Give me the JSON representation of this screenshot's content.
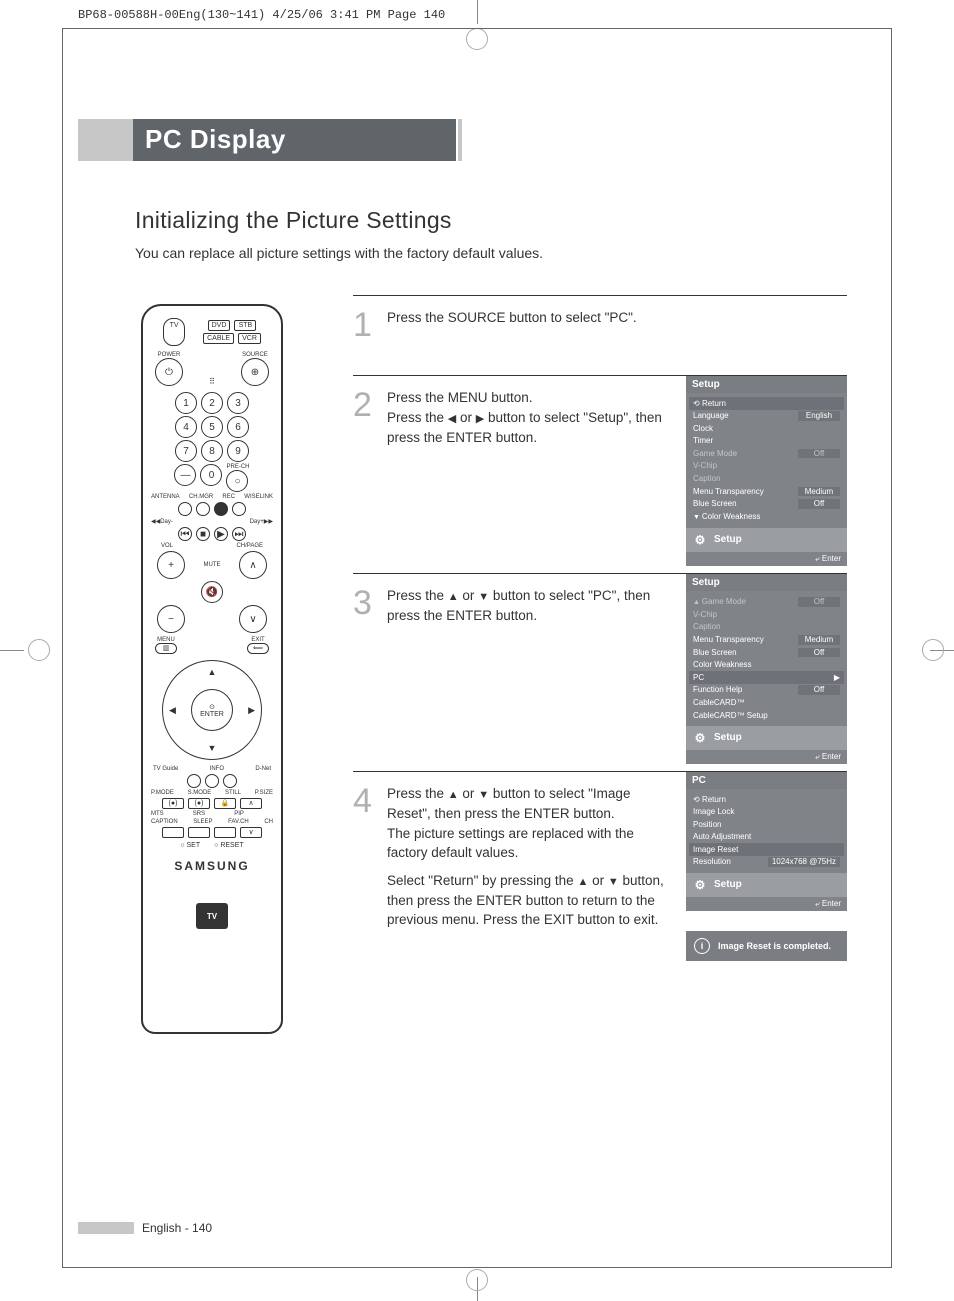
{
  "print_header": "BP68-00588H-00Eng(130~141)  4/25/06  3:41 PM  Page 140",
  "title": "PC Display",
  "subtitle": "Initializing the Picture Settings",
  "intro": "You can replace all picture settings with the factory default values.",
  "steps": {
    "s1": {
      "num": "1",
      "text": "Press the SOURCE button to select \"PC\"."
    },
    "s2": {
      "num": "2",
      "text": "Press the MENU button.\nPress the ◀ or ▶ button to select \"Setup\", then press the ENTER button."
    },
    "s3": {
      "num": "3",
      "text": "Press the ▲ or ▼ button to select \"PC\", then press the ENTER button."
    },
    "s4": {
      "num": "4",
      "text1": "Press the ▲ or ▼ button to select \"Image Reset\", then press the ENTER button.\nThe picture settings are replaced with the factory default values.",
      "text2": "Select \"Return\" by pressing the ▲ or ▼ button, then press the ENTER button to return to the previous menu. Press the EXIT button to exit."
    }
  },
  "osd1": {
    "title": "Setup",
    "return": "Return",
    "rows": [
      {
        "label": "Language",
        "value": "English"
      },
      {
        "label": "Clock",
        "value": ""
      },
      {
        "label": "Timer",
        "value": ""
      },
      {
        "label": "Game Mode",
        "value": "Off",
        "dim": true
      },
      {
        "label": "V-Chip",
        "value": "",
        "dim": true
      },
      {
        "label": "Caption",
        "value": "",
        "dim": true
      },
      {
        "label": "Menu Transparency",
        "value": "Medium"
      },
      {
        "label": "Blue Screen",
        "value": "Off"
      }
    ],
    "scroll": "Color Weakness",
    "footer": "Setup",
    "enter": "Enter"
  },
  "osd2": {
    "title": "Setup",
    "scrollup": "Game Mode",
    "scrollup_val": "Off",
    "rows": [
      {
        "label": "V-Chip",
        "value": "",
        "dim": true
      },
      {
        "label": "Caption",
        "value": "",
        "dim": true
      },
      {
        "label": "Menu Transparency",
        "value": "Medium"
      },
      {
        "label": "Blue Screen",
        "value": "Off"
      },
      {
        "label": "Color Weakness",
        "value": ""
      },
      {
        "label": "PC",
        "value": "▶",
        "sel": true
      },
      {
        "label": "Function Help",
        "value": "Off"
      },
      {
        "label": "CableCARD™",
        "value": ""
      },
      {
        "label": "CableCARD™ Setup",
        "value": ""
      }
    ],
    "footer": "Setup",
    "enter": "Enter"
  },
  "osd3": {
    "title": "PC",
    "return": "Return",
    "rows": [
      {
        "label": "Image Lock",
        "value": ""
      },
      {
        "label": "Position",
        "value": ""
      },
      {
        "label": "Auto Adjustment",
        "value": ""
      },
      {
        "label": "Image Reset",
        "value": "",
        "sel": true
      },
      {
        "label": "Resolution",
        "value": "1024x768 @75Hz"
      }
    ],
    "footer": "Setup",
    "enter": "Enter",
    "toast": "Image Reset is completed."
  },
  "remote": {
    "mode_btns": [
      "DVD",
      "STB",
      "CABLE",
      "VCR"
    ],
    "tv": "TV",
    "power": "POWER",
    "source": "SOURCE",
    "prech": "PRE-CH",
    "antenna": "ANTENNA",
    "chmgr": "CH.MGR",
    "rec": "REC",
    "wiselink": "WISELINK",
    "vol": "VOL",
    "chpage": "CH/PAGE",
    "mute": "MUTE",
    "menu": "MENU",
    "exit": "EXIT",
    "enter": "ENTER",
    "tvguide": "TV Guide",
    "info": "INFO",
    "dnet": "D-Net",
    "row_labels1": [
      "P.MODE",
      "S.MODE",
      "STILL",
      "P.SIZE"
    ],
    "row_labels2": [
      "MTS",
      "SRS",
      "PIP",
      ""
    ],
    "row_labels3": [
      "CAPTION",
      "SLEEP",
      "FAV.CH",
      "CH"
    ],
    "set": "SET",
    "reset": "RESET",
    "brand": "SAMSUNG",
    "guide": "TV"
  },
  "footer": {
    "lang": "English",
    "page": "140"
  }
}
